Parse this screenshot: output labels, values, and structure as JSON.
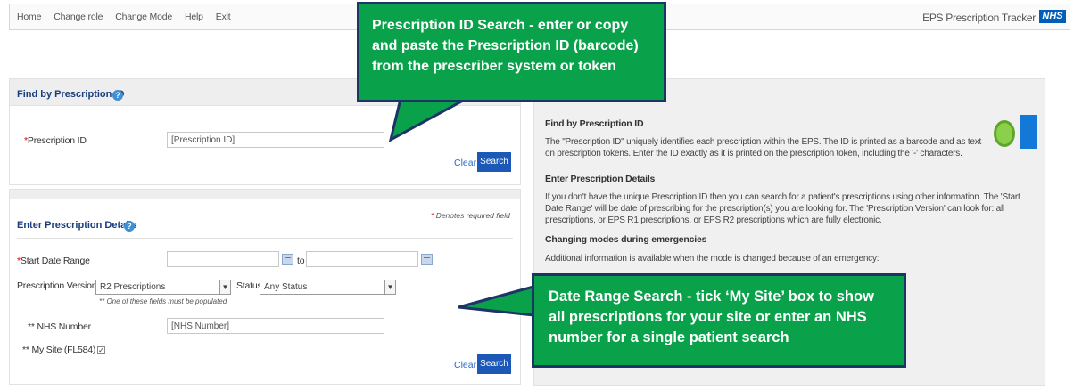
{
  "nav": {
    "links": [
      "Home",
      "Change role",
      "Change Mode",
      "Help",
      "Exit"
    ],
    "app_title": "EPS Prescription Tracker",
    "logo_text": "NHS"
  },
  "find_panel": {
    "title": "Find by Prescription ID",
    "help_glyph": "?",
    "required_mark": "*",
    "field_label": "Prescription ID",
    "field_placeholder": "[Prescription ID]",
    "clear_label": "Clear",
    "search_label": "Search"
  },
  "details_panel": {
    "title": "Enter Prescription Details",
    "help_glyph": "?",
    "required_note_mark": "*",
    "required_note": "Denotes required field",
    "start_date_label": "Start Date Range",
    "start_required_mark": "*",
    "to_label": "to",
    "version_label": "Prescription Version",
    "version_value": "R2 Prescriptions",
    "status_label": "Status",
    "status_value": "Any Status",
    "one_of_note": "** One of these fields must be populated",
    "nhs_label": "** NHS Number",
    "nhs_placeholder": "[NHS Number]",
    "mysite_label": "** My Site (FL584)",
    "mysite_checked": "✓",
    "clear_label": "Clear",
    "search_label": "Search"
  },
  "info_panel": {
    "h1": "Find by Prescription ID",
    "p1": "The \"Prescription ID\" uniquely identifies each prescription within the EPS. The ID is printed as a barcode and as text on prescription tokens. Enter the ID exactly as it is printed on the prescription token, including the '-' characters.",
    "h2": "Enter Prescription Details",
    "p2": "If you don't have the unique Prescription ID then you can search for a patient's prescriptions using other information. The 'Start Date Range' will be date of prescribing for the prescription(s) you are looking for. The 'Prescription Version' can look for: all prescriptions, or EPS R1 prescriptions, or EPS R2 prescriptions which are fully electronic.",
    "h3": "Changing modes during emergencies",
    "p3": "Additional information is available when the mode is changed because of an emergency:"
  },
  "callouts": {
    "top": "Prescription ID Search - enter or copy and paste the Prescription ID (barcode) from the prescriber system or token",
    "bottom": "Date Range Search - tick ‘My Site’ box to show all prescriptions for your site or enter an NHS number for a single patient search"
  },
  "colors": {
    "callout_fill": "#0aa14b",
    "callout_border": "#1d3566",
    "search_button": "#1b58b8",
    "title_blue": "#1a3d7c"
  }
}
